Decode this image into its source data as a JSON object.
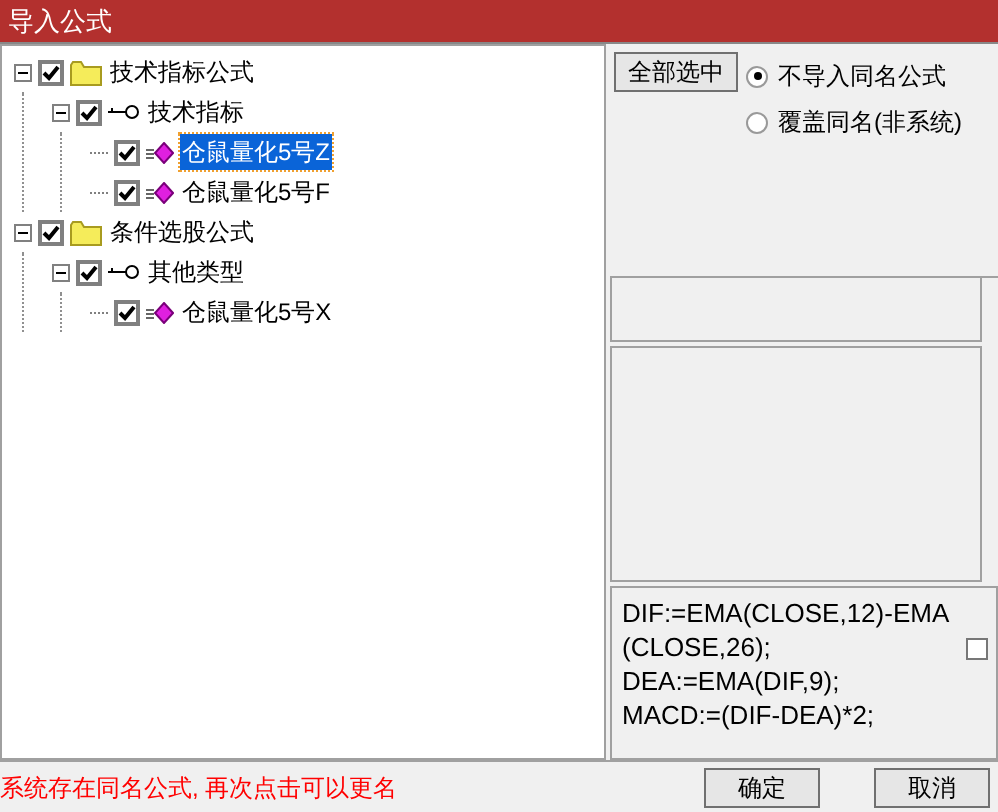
{
  "window": {
    "title": "导入公式"
  },
  "tree": [
    {
      "label": "技术指标公式",
      "kind": "folder",
      "checked": true,
      "expanded": true,
      "selected": false,
      "children": [
        {
          "label": "技术指标",
          "kind": "category",
          "checked": true,
          "expanded": true,
          "selected": false,
          "children": [
            {
              "label": "仓鼠量化5号Z",
              "kind": "formula",
              "checked": true,
              "selected": true
            },
            {
              "label": "仓鼠量化5号F",
              "kind": "formula",
              "checked": true,
              "selected": false
            }
          ]
        }
      ]
    },
    {
      "label": "条件选股公式",
      "kind": "folder",
      "checked": true,
      "expanded": true,
      "selected": false,
      "children": [
        {
          "label": "其他类型",
          "kind": "category",
          "checked": true,
          "expanded": true,
          "selected": false,
          "children": [
            {
              "label": "仓鼠量化5号X",
              "kind": "formula",
              "checked": true,
              "selected": false
            }
          ]
        }
      ]
    }
  ],
  "select_all_button": "全部选中",
  "options": [
    {
      "label": "不导入同名公式",
      "selected": true
    },
    {
      "label": "覆盖同名(非系统)",
      "selected": false
    }
  ],
  "formula_text": [
    "DIF:=EMA(CLOSE,12)-EMA",
    "(CLOSE,26);",
    "DEA:=EMA(DIF,9);",
    "MACD:=(DIF-DEA)*2;"
  ],
  "formula_checkbox": {
    "checked": false
  },
  "status_message": "系统存在同名公式, 再次点击可以更名",
  "buttons": [
    "确定",
    "取消"
  ]
}
